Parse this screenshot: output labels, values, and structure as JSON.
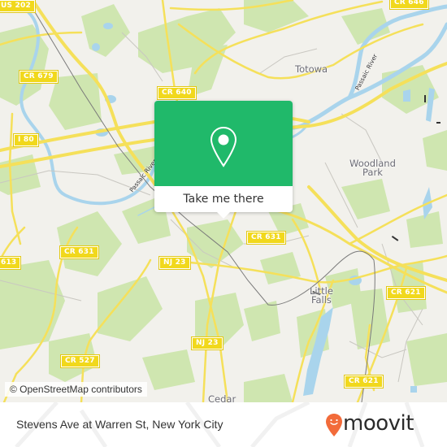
{
  "map": {
    "colors": {
      "land": "#f2f1ec",
      "park": "#cfe6b0",
      "water": "#a9d4ec",
      "road_major": "#f5e05a",
      "road_minor": "#c9c7c1",
      "rail": "#7a7a7a",
      "shield": "#f1d81c"
    },
    "route_shields": [
      {
        "id": "us-202",
        "label": "US 202"
      },
      {
        "id": "cr-646",
        "label": "CR 646"
      },
      {
        "id": "cr-679",
        "label": "CR 679"
      },
      {
        "id": "cr-640",
        "label": "CR 640"
      },
      {
        "id": "i-80",
        "label": "I 80"
      },
      {
        "id": "cr-631-a",
        "label": "CR 631"
      },
      {
        "id": "cr-631-b",
        "label": "CR 631"
      },
      {
        "id": "cr-613",
        "label": "613"
      },
      {
        "id": "nj-23-a",
        "label": "NJ 23"
      },
      {
        "id": "nj-23-b",
        "label": "NJ 23"
      },
      {
        "id": "cr-527",
        "label": "CR 527"
      },
      {
        "id": "cr-621-a",
        "label": "CR 621"
      },
      {
        "id": "cr-621-b",
        "label": "CR 621"
      }
    ],
    "places": [
      {
        "id": "totowa",
        "label": "Totowa"
      },
      {
        "id": "woodland-park",
        "label": "Woodland\nPark"
      },
      {
        "id": "little-falls",
        "label": "Little\nFalls"
      },
      {
        "id": "cedar",
        "label": "Cedar"
      }
    ],
    "waterway_labels": [
      {
        "id": "passaic-river-west",
        "label": "Passaic River"
      },
      {
        "id": "passaic-river-east",
        "label": "Passaic River"
      }
    ],
    "attribution": "© OpenStreetMap contributors"
  },
  "popup": {
    "icon": "map-pin-icon",
    "cta_label": "Take me there",
    "color": "#20b96a"
  },
  "footer": {
    "title": "Stevens Ave at Warren St, New York City",
    "brand": "moovit",
    "brand_icon": "moovit-pin-icon",
    "brand_color": "#f26b3a"
  }
}
